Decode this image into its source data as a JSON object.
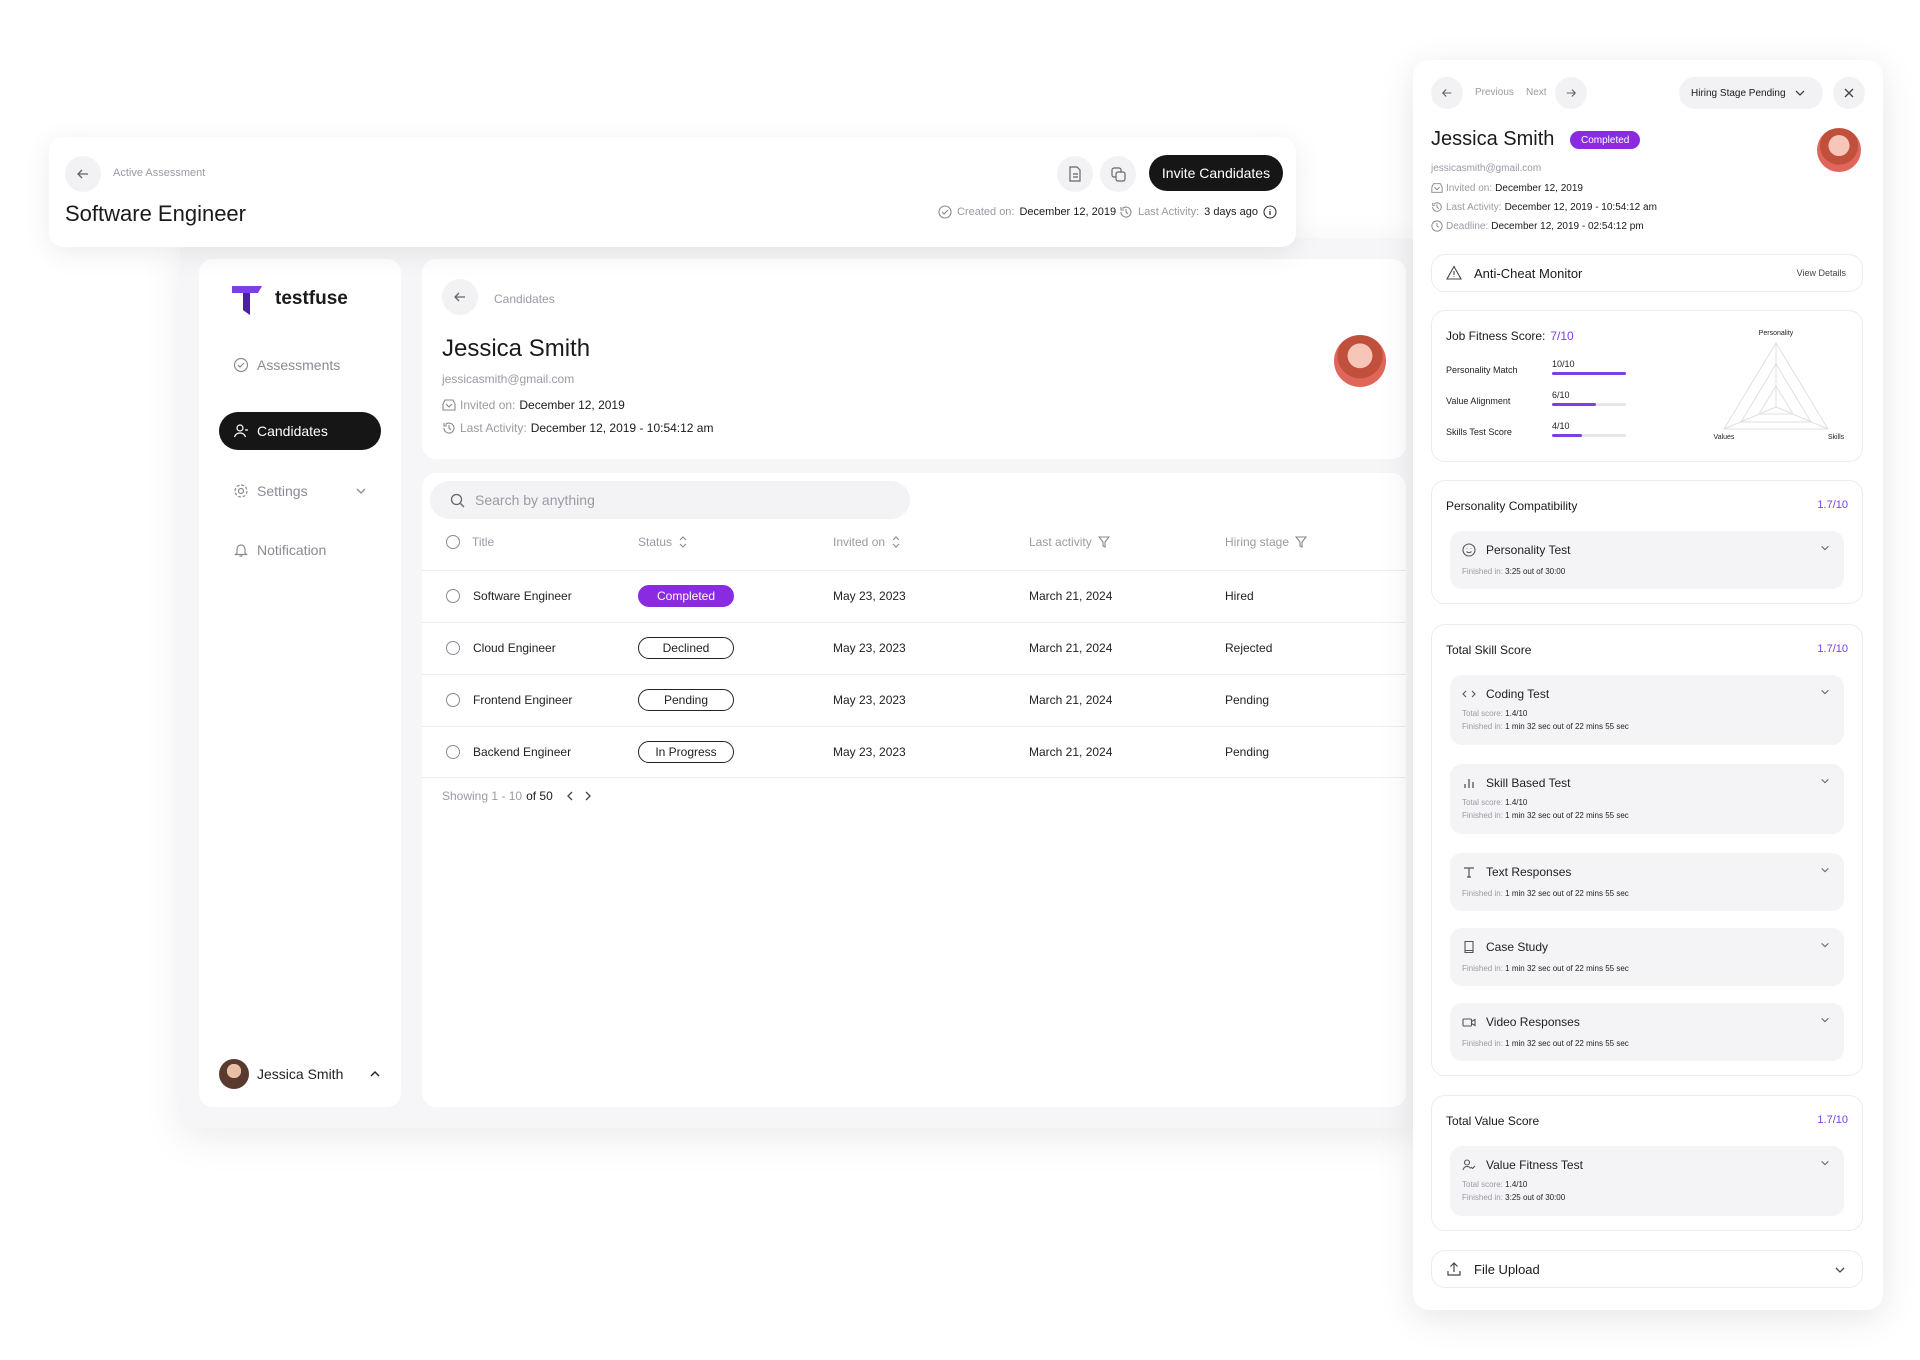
{
  "top_bar": {
    "breadcrumb": "Active Assessment",
    "title": "Software Engineer",
    "invite_button": "Invite Candidates",
    "created_label": "Created on:",
    "created_value": "December 12, 2019",
    "activity_label": "Last Activity:",
    "activity_value": "3 days ago"
  },
  "sidebar": {
    "brand": "testfuse",
    "items": [
      {
        "label": "Assessments",
        "icon": "check-circle-icon"
      },
      {
        "label": "Candidates",
        "icon": "user-icon",
        "active": true
      },
      {
        "label": "Settings",
        "icon": "gear-icon"
      },
      {
        "label": "Notification",
        "icon": "bell-icon"
      }
    ],
    "user_name": "Jessica Smith"
  },
  "candidate": {
    "breadcrumb": "Candidates",
    "name": "Jessica Smith",
    "email": "jessicasmith@gmail.com",
    "invited_label": "Invited on:",
    "invited_value": "December 12, 2019",
    "activity_label": "Last Activity:",
    "activity_value": "December 12, 2019 - 10:54:12 am"
  },
  "table": {
    "search_placeholder": "Search by anything",
    "columns": [
      "Title",
      "Status",
      "Invited on",
      "Last activity",
      "Hiring stage"
    ],
    "rows": [
      {
        "title": "Software Engineer",
        "status": "Completed",
        "invited": "May 23, 2023",
        "last": "March 21, 2024",
        "stage": "Hired"
      },
      {
        "title": "Cloud Engineer",
        "status": "Declined",
        "invited": "May 23, 2023",
        "last": "March 21, 2024",
        "stage": "Rejected"
      },
      {
        "title": "Frontend Engineer",
        "status": "Pending",
        "invited": "May 23, 2023",
        "last": "March 21, 2024",
        "stage": "Pending"
      },
      {
        "title": "Backend Engineer",
        "status": "In Progress",
        "invited": "May 23, 2023",
        "last": "March 21, 2024",
        "stage": "Pending"
      }
    ],
    "pagination_prefix": "Showing 1 - 10",
    "pagination_suffix": "of 50"
  },
  "panel": {
    "previous": "Previous",
    "next": "Next",
    "hiring_stage": "Hiring Stage Pending",
    "name": "Jessica Smith",
    "badge": "Completed",
    "email": "jessicasmith@gmail.com",
    "invited_label": "Invited on:",
    "invited_value": "December 12, 2019",
    "activity_label": "Last Activity:",
    "activity_value": "December 12, 2019 - 10:54:12 am",
    "deadline_label": "Deadline:",
    "deadline_value": "December 12, 2019 - 02:54:12 pm",
    "anti_cheat": "Anti-Cheat Monitor",
    "view_details": "View Details",
    "fitness": {
      "label": "Job Fitness Score:",
      "value": "7/10",
      "metrics": [
        {
          "label": "Personality Match",
          "value": "10/10",
          "fraction": 1.0
        },
        {
          "label": "Value Alignment",
          "value": "6/10",
          "fraction": 0.6
        },
        {
          "label": "Skills Test Score",
          "value": "4/10",
          "fraction": 0.4
        }
      ],
      "radar_labels": [
        "Personality",
        "Values",
        "Skills"
      ]
    },
    "personality": {
      "title": "Personality Compatibility",
      "score": "1.7/10",
      "test": "Personality Test",
      "finished_label": "Finished in:",
      "finished_value": "3:25 out of 30:00"
    },
    "skills": {
      "title": "Total Skill Score",
      "score": "1.7/10",
      "total_label": "Total score:",
      "finished_label": "Finished in:",
      "tests": [
        {
          "name": "Coding Test",
          "total": "1.4/10",
          "finished": "1 min 32 sec out of 22 mins 55 sec"
        },
        {
          "name": "Skill Based Test",
          "total": "1.4/10",
          "finished": "1 min 32 sec out of 22 mins 55 sec"
        },
        {
          "name": "Text Responses",
          "finished": "1 min 32 sec out of 22 mins 55 sec"
        },
        {
          "name": "Case Study",
          "finished": "1 min 32 sec out of 22 mins 55 sec"
        },
        {
          "name": "Video Responses",
          "finished": "1 min 32 sec out of 22 mins 55 sec"
        }
      ]
    },
    "values": {
      "title": "Total Value Score",
      "score": "1.7/10",
      "test": "Value Fitness Test",
      "total_label": "Total score:",
      "total_value": "1.4/10",
      "finished_label": "Finished in:",
      "finished_value": "3:25 out of 30:00"
    },
    "file_upload": "File Upload"
  }
}
